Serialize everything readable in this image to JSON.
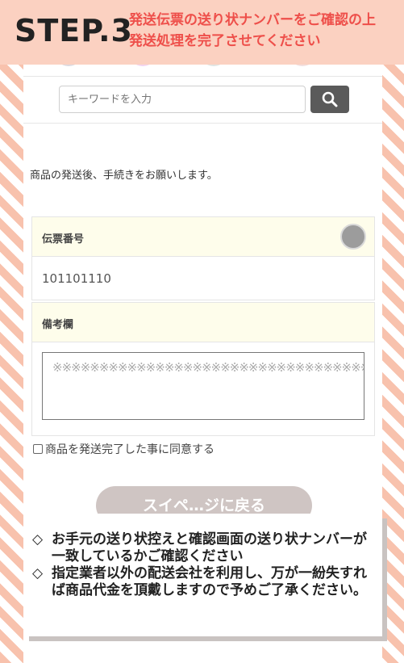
{
  "header": {
    "step": "STEP.3",
    "line1": "発送伝票の送り状ナンバーをご確認の上",
    "line2": "発送処理を完了させてください"
  },
  "search": {
    "placeholder": "キーワードを入力"
  },
  "main": {
    "intro": "商品の発送後、手続きをお願いします。",
    "slip_label": "伝票番号",
    "slip_value": "101101110",
    "remarks_label": "備考欄",
    "remarks_value": "※※※※※※※※※※※※※※※※※※※※※※※※※※※※※※※※※※※※※※※※※",
    "agree_label": "商品を発送完了した事に同意する",
    "submit_label": "スイペ…ジに戻る"
  },
  "note": {
    "mark": "◇",
    "item1": "お手元の送り状控えと確認画面の送り状ナンバーが一致しているかご確認ください",
    "item2": "指定業者以外の配送会社を利用し、万が一紛失すれば商品代金を頂戴しますので予めご了承ください。"
  },
  "colors": {
    "header_bg": "#fbd1c1",
    "header_text": "#ee4f4a",
    "stripe": "#f8c2ad",
    "label_bg": "#fefdeb",
    "search_button": "#5a5a5a"
  }
}
